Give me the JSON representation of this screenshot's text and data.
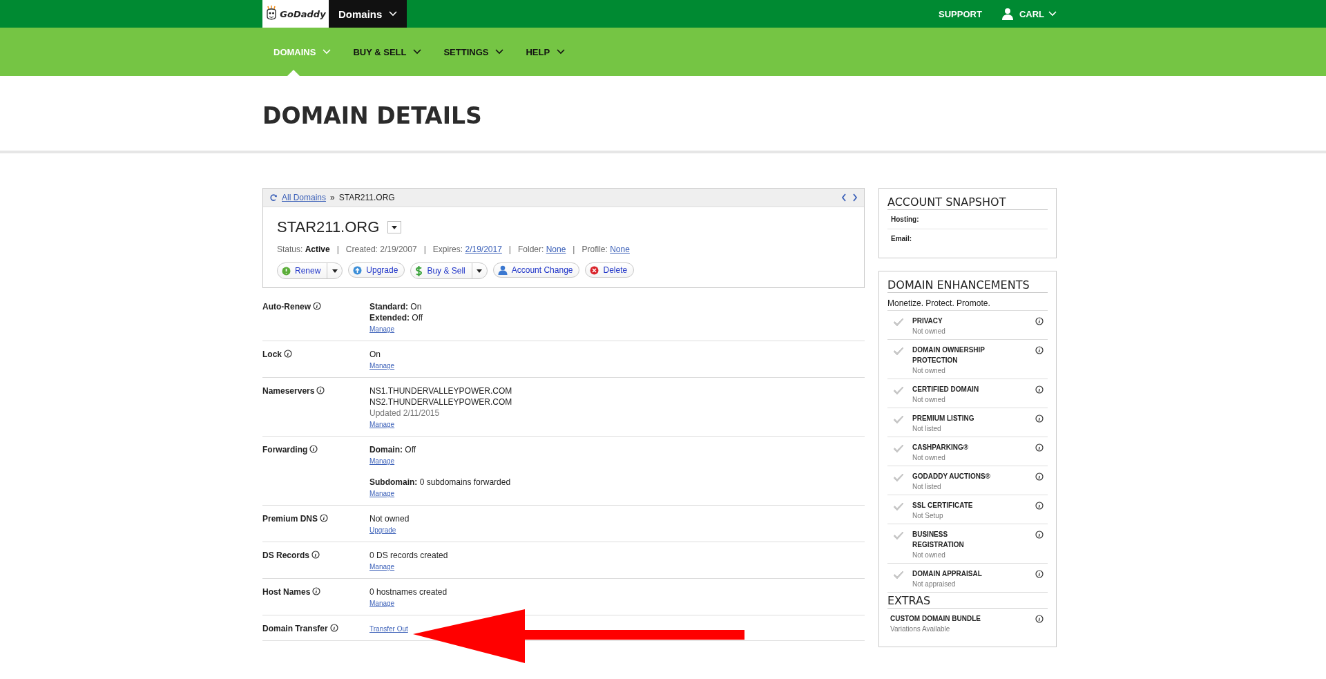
{
  "top_bar": {
    "logo": "GoDaddy",
    "product_menu": "Domains",
    "support": "SUPPORT",
    "user": "CARL"
  },
  "nav": [
    {
      "label": "DOMAINS",
      "selected": true
    },
    {
      "label": "BUY & SELL",
      "selected": false
    },
    {
      "label": "SETTINGS",
      "selected": false
    },
    {
      "label": "HELP",
      "selected": false
    }
  ],
  "page_title": "DOMAIN DETAILS",
  "breadcrumb": {
    "link": "All Domains",
    "separator": "»",
    "current": "STAR211.ORG"
  },
  "domain": {
    "name": "STAR211.ORG",
    "separator": "|",
    "meta": [
      {
        "label": "Status:",
        "value": "Active",
        "kind": "bold"
      },
      {
        "label": "Created:",
        "value": "2/19/2007",
        "kind": "plain"
      },
      {
        "label": "Expires:",
        "value": "2/19/2017",
        "kind": "link"
      },
      {
        "label": "Folder:",
        "value": "None",
        "kind": "link"
      },
      {
        "label": "Profile:",
        "value": "None",
        "kind": "link"
      }
    ],
    "actions": [
      {
        "label": "Renew",
        "kind": "renew",
        "has_menu": true
      },
      {
        "label": "Upgrade",
        "kind": "upgrade",
        "has_menu": false
      },
      {
        "label": "Buy & Sell",
        "kind": "dollar",
        "has_menu": true
      },
      {
        "label": "Account Change",
        "kind": "person",
        "has_menu": false
      },
      {
        "label": "Delete",
        "kind": "delete",
        "has_menu": false
      }
    ]
  },
  "settings": [
    {
      "label": "Auto-Renew",
      "groups": [
        [
          {
            "kind": "text",
            "text": "**Standard:** On"
          },
          {
            "kind": "text",
            "text": "**Extended:** Off"
          },
          {
            "kind": "link",
            "text": "Manage"
          }
        ]
      ]
    },
    {
      "label": "Lock",
      "groups": [
        [
          {
            "kind": "text",
            "text": "On"
          },
          {
            "kind": "link",
            "text": "Manage"
          }
        ]
      ]
    },
    {
      "label": "Nameservers",
      "groups": [
        [
          {
            "kind": "text",
            "text": "NS1.THUNDERVALLEYPOWER.COM"
          },
          {
            "kind": "text",
            "text": "NS2.THUNDERVALLEYPOWER.COM"
          },
          {
            "kind": "muted",
            "text": "Updated 2/11/2015"
          },
          {
            "kind": "link",
            "text": "Manage"
          }
        ]
      ]
    },
    {
      "label": "Forwarding",
      "groups": [
        [
          {
            "kind": "text",
            "text": "**Domain:** Off"
          },
          {
            "kind": "link",
            "text": "Manage"
          }
        ],
        [
          {
            "kind": "text",
            "text": "**Subdomain:** 0 subdomains forwarded"
          },
          {
            "kind": "link",
            "text": "Manage"
          }
        ]
      ]
    },
    {
      "label": "Premium DNS",
      "groups": [
        [
          {
            "kind": "text",
            "text": "Not owned"
          },
          {
            "kind": "link",
            "text": "Upgrade"
          }
        ]
      ]
    },
    {
      "label": "DS Records",
      "groups": [
        [
          {
            "kind": "text",
            "text": "0 DS records created"
          },
          {
            "kind": "link",
            "text": "Manage"
          }
        ]
      ]
    },
    {
      "label": "Host Names",
      "groups": [
        [
          {
            "kind": "text",
            "text": "0 hostnames created"
          },
          {
            "kind": "link",
            "text": "Manage"
          }
        ]
      ]
    },
    {
      "label": "Domain Transfer",
      "groups": [
        [
          {
            "kind": "link",
            "text": "Transfer Out"
          }
        ]
      ]
    }
  ],
  "account_snapshot": {
    "title": "ACCOUNT SNAPSHOT",
    "items": [
      "Hosting:",
      "Email:"
    ]
  },
  "domain_enhancements": {
    "title": "DOMAIN ENHANCEMENTS",
    "tagline": "Monetize. Protect. Promote.",
    "items": [
      {
        "name": "PRIVACY",
        "status": "Not owned"
      },
      {
        "name": "DOMAIN OWNERSHIP PROTECTION",
        "status": "Not owned"
      },
      {
        "name": "CERTIFIED DOMAIN",
        "status": "Not owned"
      },
      {
        "name": "PREMIUM LISTING",
        "status": "Not listed"
      },
      {
        "name": "CASHPARKING®",
        "status": "Not owned"
      },
      {
        "name": "GODADDY AUCTIONS®",
        "status": "Not listed"
      },
      {
        "name": "SSL CERTIFICATE",
        "status": "Not Setup"
      },
      {
        "name": "BUSINESS REGISTRATION",
        "status": "Not owned"
      },
      {
        "name": "DOMAIN APPRAISAL",
        "status": "Not appraised"
      }
    ],
    "extras_title": "EXTRAS",
    "extras": [
      {
        "name": "CUSTOM DOMAIN BUNDLE",
        "status": "Variations Available"
      }
    ]
  }
}
